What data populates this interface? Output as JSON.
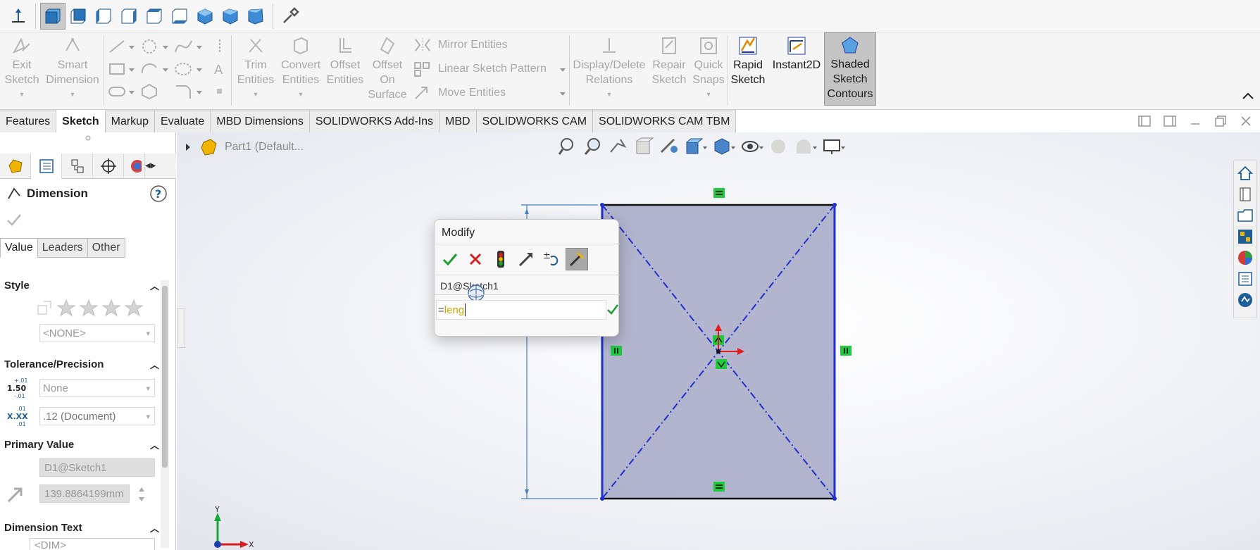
{
  "ribbon": {
    "exit_sketch": "Exit\nSketch",
    "smart_dimension": "Smart\nDimension",
    "trim_entities": "Trim\nEntities",
    "convert_entities": "Convert\nEntities",
    "offset_entities": "Offset\nEntities",
    "offset_on_surface": "Offset\nOn\nSurface",
    "mirror_entities": "Mirror Entities",
    "linear_sketch_pattern": "Linear Sketch Pattern",
    "move_entities": "Move Entities",
    "display_delete_relations": "Display/Delete\nRelations",
    "repair_sketch": "Repair\nSketch",
    "quick_snaps": "Quick\nSnaps",
    "rapid_sketch": "Rapid\nSketch",
    "instant2d": "Instant2D",
    "shaded_sketch_contours": "Shaded\nSketch\nContours"
  },
  "tabs": [
    "Features",
    "Sketch",
    "Markup",
    "Evaluate",
    "MBD Dimensions",
    "SOLIDWORKS Add-Ins",
    "MBD",
    "SOLIDWORKS CAM",
    "SOLIDWORKS CAM TBM"
  ],
  "active_tab": "Sketch",
  "panel": {
    "title": "Dimension",
    "subtabs": [
      "Value",
      "Leaders",
      "Other"
    ],
    "style_header": "Style",
    "style_value": "<NONE>",
    "tolerance_header": "Tolerance/Precision",
    "tolerance_value": "None",
    "precision_value": ".12 (Document)",
    "primary_header": "Primary Value",
    "primary_name": "D1@Sketch1",
    "primary_value": "139.8864199mm",
    "dimtext_header": "Dimension Text",
    "dimtext_value": "<DIM>"
  },
  "tree": {
    "part_label": "Part1 (Default..."
  },
  "modify": {
    "title": "Modify",
    "dimension_name": "D1@Sketch1",
    "input_prefix": "=",
    "input_text": "leng"
  },
  "colors": {
    "sketch_blue": "#1f2fd0",
    "relation_green": "#22c940",
    "face_fill": "#a4a8c4",
    "ok_green": "#1e9e2e",
    "cancel_red": "#d61f1f"
  }
}
